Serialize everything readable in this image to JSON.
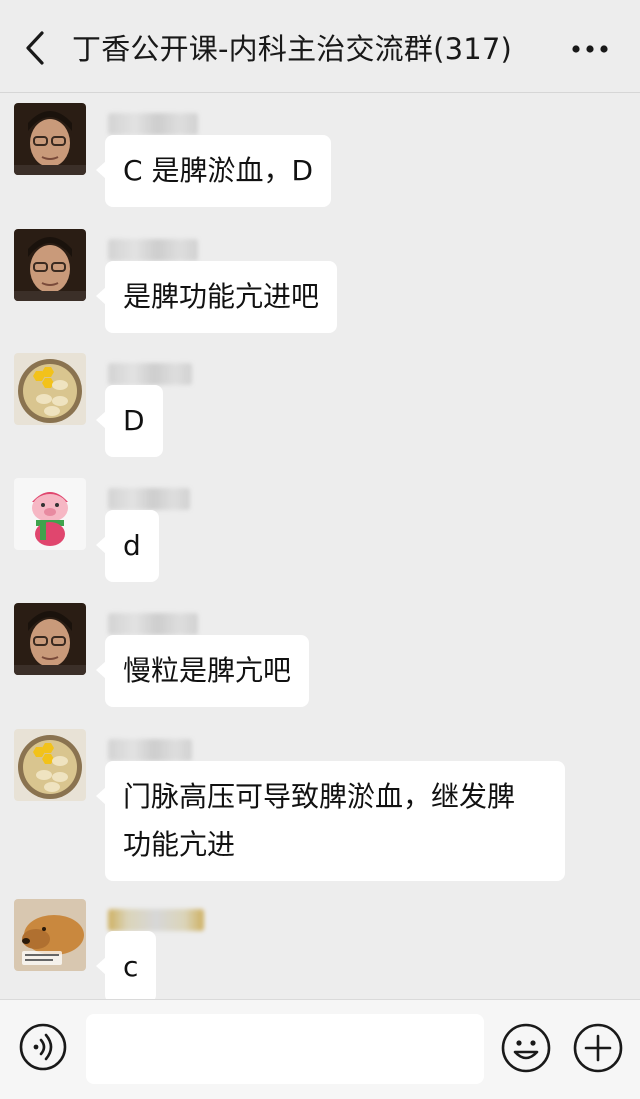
{
  "header": {
    "title": "丁香公开课-内科主治交流群(317)",
    "back_icon": "chevron-left-icon",
    "more_icon": "more-dots-icon"
  },
  "messages": [
    {
      "sender_avatar": "man-portrait-avatar",
      "nickname_blurred": true,
      "text": "C 是脾淤血，D"
    },
    {
      "sender_avatar": "man-portrait-avatar",
      "nickname_blurred": true,
      "text": "是脾功能亢进吧"
    },
    {
      "sender_avatar": "dumplings-bowl-avatar",
      "nickname_blurred": true,
      "text": "D"
    },
    {
      "sender_avatar": "pig-doll-avatar",
      "nickname_blurred": true,
      "text": "d"
    },
    {
      "sender_avatar": "man-portrait-avatar",
      "nickname_blurred": true,
      "text": "慢粒是脾亢吧"
    },
    {
      "sender_avatar": "dumplings-bowl-avatar",
      "nickname_blurred": true,
      "text_line1": "门脉高压可导致脾淤血，继发脾",
      "text_line2": "功能亢进"
    },
    {
      "sender_avatar": "dog-avatar",
      "nickname_blurred": true,
      "text": "c"
    }
  ],
  "input_bar": {
    "voice_icon": "voice-icon",
    "input_value": "",
    "emoji_icon": "emoji-icon",
    "plus_icon": "plus-circle-icon"
  },
  "colors": {
    "background": "#ededed",
    "bubble": "#ffffff",
    "text": "#111111"
  }
}
